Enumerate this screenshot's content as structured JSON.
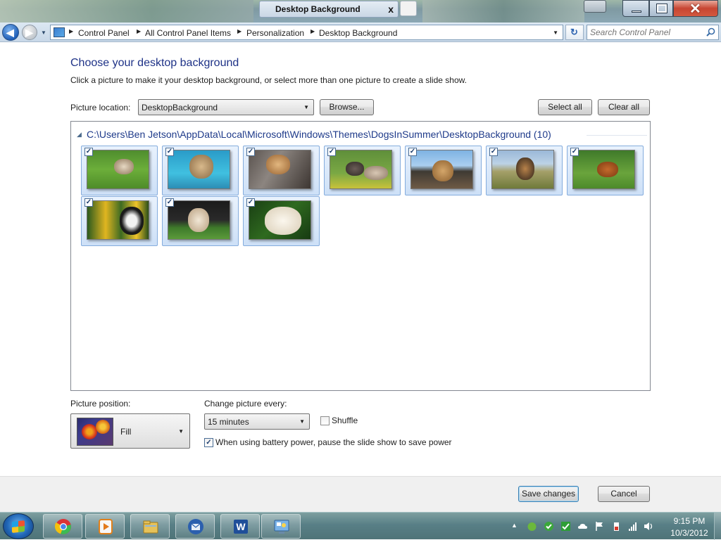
{
  "window": {
    "title": "Desktop Background",
    "close_glyph": "x"
  },
  "address": {
    "crumbs": [
      "Control Panel",
      "All Control Panel Items",
      "Personalization",
      "Desktop Background"
    ],
    "search_placeholder": "Search Control Panel"
  },
  "content": {
    "title": "Choose your desktop background",
    "subtitle": "Click a picture to make it your desktop background, or select more than one picture to create a slide show.",
    "location_label": "Picture location:",
    "location_value": "DesktopBackground",
    "browse_label": "Browse...",
    "select_all_label": "Select all",
    "clear_all_label": "Clear all",
    "group_path": "C:\\Users\\Ben Jetson\\AppData\\Local\\Microsoft\\Windows\\Themes\\DogsInSummer\\DesktopBackground (10)",
    "thumbnails": [
      {
        "name": "yorkie-on-grass",
        "checked": true
      },
      {
        "name": "dog-swimming",
        "checked": true
      },
      {
        "name": "dog-by-log",
        "checked": true
      },
      {
        "name": "dogs-in-flowers",
        "checked": true
      },
      {
        "name": "dog-on-rocks",
        "checked": true
      },
      {
        "name": "puppy-on-hill",
        "checked": true
      },
      {
        "name": "dog-in-field",
        "checked": true
      },
      {
        "name": "bulldog-in-daffodils",
        "checked": true
      },
      {
        "name": "puppy-running",
        "checked": true
      },
      {
        "name": "white-retriever",
        "checked": true
      }
    ]
  },
  "settings": {
    "position_label": "Picture position:",
    "position_value": "Fill",
    "change_label": "Change picture every:",
    "interval_value": "15 minutes",
    "shuffle_label": "Shuffle",
    "shuffle_checked": false,
    "battery_label": "When using battery power, pause the slide show to save power",
    "battery_checked": true
  },
  "footer": {
    "save_label": "Save changes",
    "cancel_label": "Cancel"
  },
  "taskbar": {
    "apps": [
      "chrome-icon",
      "media-player-icon",
      "file-explorer-icon",
      "thunderbird-icon",
      "word-icon",
      "control-panel-icon"
    ],
    "time": "9:15 PM",
    "date": "10/3/2012"
  },
  "colors": {
    "title_blue": "#1e3287",
    "thumb_selection": "#cde0f7",
    "taskbar": "#587f86"
  }
}
